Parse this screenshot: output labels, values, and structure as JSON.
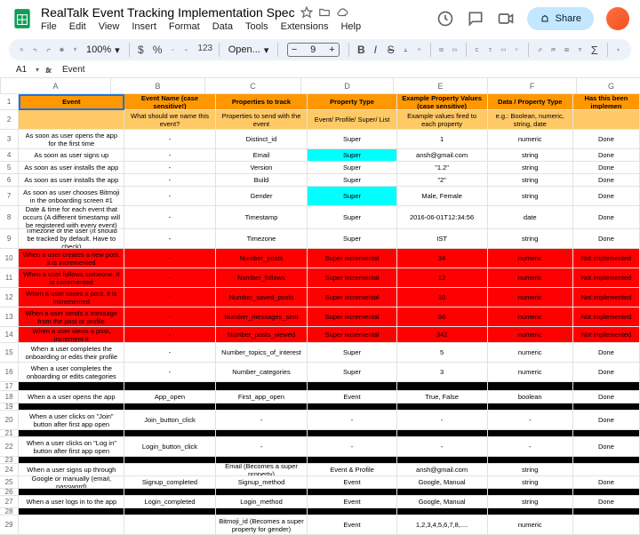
{
  "doc": {
    "title": "RealTalk Event Tracking Implementation Spec",
    "share": "Share"
  },
  "menu": [
    "File",
    "Edit",
    "View",
    "Insert",
    "Format",
    "Data",
    "Tools",
    "Extensions",
    "Help"
  ],
  "toolbar": {
    "zoom": "100%",
    "font": "Open...",
    "fontsize": "9"
  },
  "namebox": "A1",
  "formula": "Event",
  "cols": [
    "A",
    "B",
    "C",
    "D",
    "E",
    "F",
    "G"
  ],
  "colWidths": [
    "cw-a",
    "cw-b",
    "cw-c",
    "cw-d",
    "cw-e",
    "cw-f",
    "cw-g"
  ],
  "rows": [
    {
      "n": 1,
      "h": 18,
      "cls": "row-1",
      "c": [
        "Event",
        "Event Name (case sensitive!)",
        "Properties to track",
        "Property Type",
        "Example Property Values (case sensitive)",
        "Data / Property Type",
        "Has this been implemen"
      ]
    },
    {
      "n": 2,
      "h": 22,
      "cls": "row-2",
      "c": [
        "",
        "What should we name this event?",
        "Properties to send with the event",
        "Event/ Profile/ Super/ List",
        "Example values fired to each property",
        "e.g.: Boolean, numeric, string, date",
        ""
      ]
    },
    {
      "n": 3,
      "h": 22,
      "cls": "",
      "c": [
        "As soon as user opens the app for the first time",
        "-",
        "Distinct_id",
        "Super",
        "1",
        "numeric",
        "Done"
      ]
    },
    {
      "n": 4,
      "h": 14,
      "cls": "",
      "c": [
        "As soon as user signs up",
        "-",
        "Email",
        "Super",
        "ansh@gmail.com",
        "string",
        "Done"
      ],
      "cyan": [
        3
      ]
    },
    {
      "n": 5,
      "h": 14,
      "cls": "",
      "c": [
        "As soon as user installs the app",
        "-",
        "Version",
        "Super",
        "\"1.2\"",
        "string",
        "Done"
      ]
    },
    {
      "n": 6,
      "h": 14,
      "cls": "",
      "c": [
        "As soon as user installs the app",
        "-",
        "Build",
        "Super",
        "\"2\"",
        "string",
        "Done"
      ]
    },
    {
      "n": 7,
      "h": 22,
      "cls": "",
      "c": [
        "As soon as user chooses Bitmoji in the onboarding screen #1",
        "-",
        "Gender",
        "Super",
        "Male, Female",
        "string",
        "Done"
      ],
      "cyan": [
        3
      ]
    },
    {
      "n": 8,
      "h": 26,
      "cls": "",
      "c": [
        "Date & time for each event that occurs (A different timestamp will be registered with every event)",
        "-",
        "Timestamp",
        "Super",
        "2016-06-01T12:34:56",
        "date",
        "Done"
      ]
    },
    {
      "n": 9,
      "h": 22,
      "cls": "",
      "c": [
        "Timezone of the user (It should be tracked by default. Have to check)",
        "-",
        "Timezone",
        "Super",
        "IST",
        "string",
        "Done"
      ]
    },
    {
      "n": 10,
      "h": 22,
      "cls": "row-red",
      "c": [
        "When a user creates a new post, it is incremented",
        "-",
        "Number_posts",
        "Super incremental",
        "34",
        "numeric",
        "Not implemented"
      ]
    },
    {
      "n": 11,
      "h": 22,
      "cls": "row-red",
      "c": [
        "When a user follows someone, it is incremented",
        "-",
        "Number_follows",
        "Super incremental",
        "12",
        "numeric",
        "Not implemented"
      ]
    },
    {
      "n": 12,
      "h": 22,
      "cls": "row-red",
      "c": [
        "When a user saves a post, it is incremented",
        "-",
        "Number_saved_posts",
        "Super incremental",
        "10",
        "numeric",
        "Not implemented"
      ]
    },
    {
      "n": 13,
      "h": 22,
      "cls": "row-red",
      "c": [
        "When a user sends a message from the post or profile",
        "-",
        "Number_messages_sent",
        "Super incremental",
        "50",
        "numeric",
        "Not implemented"
      ]
    },
    {
      "n": 14,
      "h": 18,
      "cls": "row-red",
      "c": [
        "When a user views a post, increment it",
        "-",
        "Number_posts_viewed",
        "Super incremental",
        "342",
        "numeric",
        "Not implemented"
      ]
    },
    {
      "n": 15,
      "h": 22,
      "cls": "",
      "c": [
        "When a user completes the onboarding or edits their profile",
        "-",
        "Number_topics_of_interest",
        "Super",
        "5",
        "numeric",
        "Done"
      ]
    },
    {
      "n": 16,
      "h": 22,
      "cls": "",
      "c": [
        "When a user completes the onboarding or edits categories",
        "-",
        "Number_categories",
        "Super",
        "3",
        "numeric",
        "Done"
      ]
    },
    {
      "n": 17,
      "h": 10,
      "cls": "row-black",
      "c": [
        "",
        "",
        "",
        "",
        "",
        "",
        ""
      ]
    },
    {
      "n": 18,
      "h": 14,
      "cls": "",
      "c": [
        "When a a user opens the app",
        "App_open",
        "First_app_open",
        "Event",
        "True, False",
        "boolean",
        "Done"
      ]
    },
    {
      "n": 19,
      "h": 8,
      "cls": "row-black",
      "c": [
        "",
        "",
        "",
        "",
        "",
        "",
        ""
      ]
    },
    {
      "n": 20,
      "h": 22,
      "cls": "",
      "c": [
        "When a user clicks on \"Join\" button after first app open",
        "Join_button_click",
        "-",
        "-",
        "-",
        "-",
        "Done"
      ]
    },
    {
      "n": 21,
      "h": 8,
      "cls": "row-black",
      "c": [
        "",
        "",
        "",
        "",
        "",
        "",
        ""
      ]
    },
    {
      "n": 22,
      "h": 22,
      "cls": "",
      "c": [
        "When a user clicks on \"Log in\" button after first app open",
        "Login_button_click",
        "-",
        "-",
        "-",
        "-",
        "Done"
      ]
    },
    {
      "n": 23,
      "h": 8,
      "cls": "row-black",
      "c": [
        "",
        "",
        "",
        "",
        "",
        "",
        ""
      ]
    },
    {
      "n": 24,
      "h": 14,
      "cls": "",
      "c": [
        "When a user signs up through",
        "",
        "Email (Becomes a super property)",
        "Event & Profile",
        "ansh@gmail.com",
        "string",
        ""
      ]
    },
    {
      "n": 25,
      "h": 14,
      "cls": "",
      "c": [
        "Google or manually (email, password)",
        "Signup_completed",
        "Signup_method",
        "Event",
        "Google, Manual",
        "string",
        "Done"
      ]
    },
    {
      "n": 26,
      "h": 8,
      "cls": "row-black",
      "c": [
        "",
        "",
        "",
        "",
        "",
        "",
        ""
      ]
    },
    {
      "n": 27,
      "h": 14,
      "cls": "",
      "c": [
        "When a user logs in to the app",
        "Login_completed",
        "Login_method",
        "Event",
        "Google, Manual",
        "string",
        "Done"
      ]
    },
    {
      "n": 28,
      "h": 8,
      "cls": "row-black",
      "c": [
        "",
        "",
        "",
        "",
        "",
        "",
        ""
      ]
    },
    {
      "n": 29,
      "h": 22,
      "cls": "",
      "c": [
        "",
        "",
        "Bitmoji_id (Becomes a super property for gender)",
        "Event",
        "1,2,3,4,5,6,7,8,....",
        "numeric",
        ""
      ]
    }
  ]
}
